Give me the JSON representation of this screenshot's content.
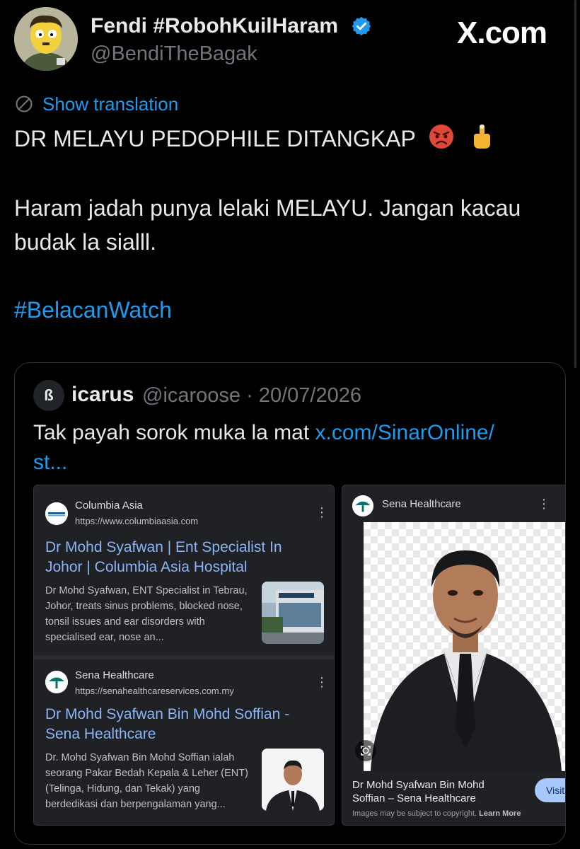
{
  "header": {
    "display_name": "Fendi #RobohKuilHaram",
    "handle": "@BendiTheBagak",
    "brand": "X.com",
    "verified_icon": "verified-badge-icon",
    "accent": "#1d9bf0"
  },
  "translate": {
    "label": "Show translation",
    "icon": "translate-globe-icon"
  },
  "tweet": {
    "line1": "DR MELAYU PEDOPHILE DITANGKAP",
    "emojis": [
      "angry-face-emoji",
      "middle-finger-emoji"
    ],
    "paragraph2": "Haram jadah punya lelaki MELAYU. Jangan kacau budak la sialll.",
    "hashtag": "#BelacanWatch"
  },
  "quote": {
    "avatar_letter": "ß",
    "name": "icarus",
    "handle": "@icaroose",
    "separator": "·",
    "date": "20/07/2026",
    "text_prefix": "Tak payah sorok muka la mat ",
    "link_text": "x.com/SinarOnline/",
    "link_tail": "st..."
  },
  "search_results": [
    {
      "site": "Columbia Asia",
      "url": "https://www.columbiaasia.com",
      "title": "Dr Mohd Syafwan | Ent Specialist In Johor | Columbia Asia Hospital",
      "snippet": "Dr Mohd Syafwan, ENT Specialist in Tebrau, Johor, treats sinus problems, blocked nose, tonsil issues and ear disorders with specialised ear, nose an..."
    },
    {
      "site": "Sena Healthcare",
      "url": "https://senahealthcareservices.com.my",
      "title": "Dr Mohd Syafwan Bin Mohd Soffian - Sena Healthcare",
      "snippet": "Dr. Mohd Syafwan Bin Mohd Soffian ialah seorang Pakar Bedah Kepala & Leher (ENT) (Telinga, Hidung, dan Tekak) yang berdedikasi dan berpengalaman yang..."
    }
  ],
  "image_panel": {
    "site": "Sena Healthcare",
    "caption": "Dr Mohd Syafwan Bin Mohd Soffian – Sena Healthcare",
    "visit_label": "Visit",
    "copyright": "Images may be subject to copyright.",
    "learn_more": "Learn More"
  }
}
